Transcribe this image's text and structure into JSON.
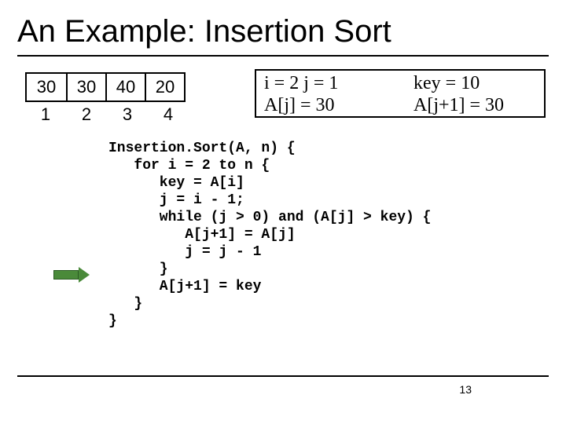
{
  "title": "An Example: Insertion Sort",
  "array": {
    "cells": [
      "30",
      "30",
      "40",
      "20"
    ],
    "indices": [
      "1",
      "2",
      "3",
      "4"
    ]
  },
  "status": {
    "r1l": "i = 2    j = 1",
    "r1r": "key = 10",
    "r2l": "A[j] = 30",
    "r2r": "A[j+1] = 30"
  },
  "code": "Insertion.Sort(A, n) {\n   for i = 2 to n {\n      key = A[i]\n      j = i - 1;\n      while (j > 0) and (A[j] > key) {\n         A[j+1] = A[j]\n         j = j - 1\n      }\n      A[j+1] = key\n   }\n}",
  "page": "13"
}
